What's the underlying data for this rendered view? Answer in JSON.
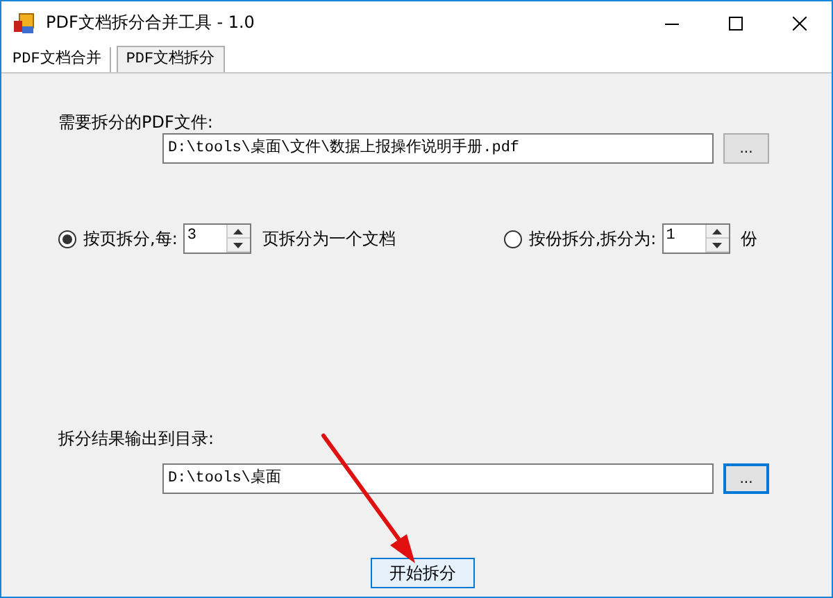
{
  "window": {
    "title": "PDF文档拆分合并工具 - 1.0"
  },
  "tabs": [
    {
      "label": "PDF文档合并",
      "selected": false
    },
    {
      "label": "PDF文档拆分",
      "selected": true
    }
  ],
  "source": {
    "label": "需要拆分的PDF文件:",
    "value": "D:\\tools\\桌面\\文件\\数据上报操作说明手册.pdf",
    "browse": {
      "label": "...",
      "focused": false
    }
  },
  "modes": [
    {
      "label": "按页拆分,每:",
      "value": "3",
      "suffix": "页拆分为一个文档",
      "selected": true
    },
    {
      "label": "按份拆分,拆分为:",
      "value": "1",
      "suffix": "份",
      "selected": false
    }
  ],
  "output": {
    "label": "拆分结果输出到目录:",
    "value": "D:\\tools\\桌面",
    "browse": {
      "label": "...",
      "focused": true
    }
  },
  "start_button": "开始拆分"
}
